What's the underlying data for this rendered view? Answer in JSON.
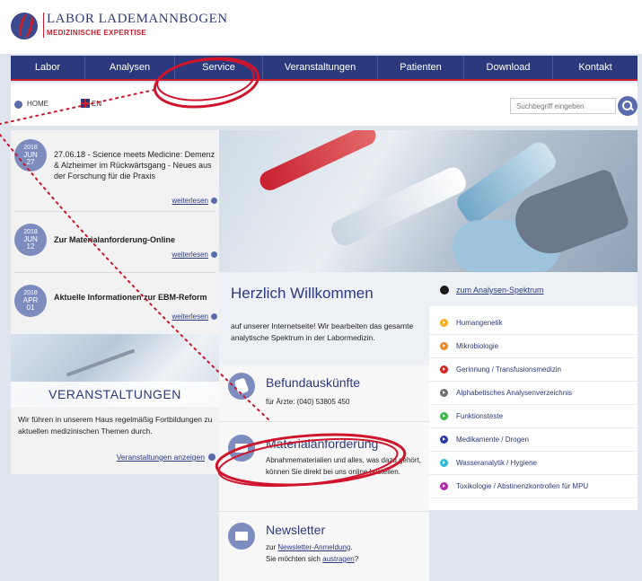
{
  "header": {
    "title": "LABOR LADEMANNBOGEN",
    "subtitle": "MEDIZINISCHE EXPERTISE"
  },
  "nav": {
    "items": [
      {
        "label": "Labor",
        "width": 83
      },
      {
        "label": "Analysen",
        "width": 100
      },
      {
        "label": "Service",
        "width": 98
      },
      {
        "label": "Veranstaltungen",
        "width": 128
      },
      {
        "label": "Patienten",
        "width": 96
      },
      {
        "label": "Download",
        "width": 99
      },
      {
        "label": "Kontakt",
        "width": 94
      }
    ]
  },
  "breadcrumb": {
    "home": "HOME",
    "lang": "EN"
  },
  "search": {
    "placeholder": "Suchbegriff eingeben"
  },
  "news": [
    {
      "year": "2018",
      "month": "JUN",
      "day": "27",
      "text": "27.06.18 - Science meets Medicine: Demenz & Alzheimer im Rückwärtsgang - Neues aus der Forschung für die Praxis",
      "more": "weiterlesen"
    },
    {
      "year": "2018",
      "month": "JUN",
      "day": "12",
      "text": "Zur Materialanforderung-Online",
      "more": "weiterlesen"
    },
    {
      "year": "2018",
      "month": "APR",
      "day": "01",
      "text": "Aktuelle Informationen zur EBM-Reform",
      "more": "weiterlesen"
    }
  ],
  "events": {
    "title": "VERANSTALTUNGEN",
    "text": "Wir führen in unserem Haus regelmäßig Fortbildungen zu aktuellen medizinischen Themen durch.",
    "link": "Veranstaltungen anzeigen"
  },
  "welcome": {
    "title": "Herzlich Willkommen",
    "text": "auf unserer Internetseite! Wir bearbeiten das gesamte analytische Spektrum in der Labormedizin."
  },
  "services": [
    {
      "title": "Befundauskünfte",
      "text": "für Ärzte: (040) 53805 450"
    },
    {
      "title": "Materialanforderung",
      "text": "Abnahmematerialien und alles, was dazu gehört, können Sie direkt bei uns online bestellen."
    },
    {
      "title": "Newsletter",
      "text_prefix": "zur ",
      "link1": "Newsletter-Anmeldung",
      "text_mid": ".",
      "text2": "Sie möchten sich ",
      "link2": "austragen",
      "text_end": "?"
    }
  ],
  "spectrum": {
    "head": "zum Analysen-Spektrum",
    "items": [
      {
        "label": "Humangenetik",
        "color": "#f2b01e"
      },
      {
        "label": "Mikrobiologie",
        "color": "#e8882a"
      },
      {
        "label": "Gerinnung / Transfusionsmedizin",
        "color": "#d42424"
      },
      {
        "label": "Alphabetisches Analysenverzeichnis",
        "color": "#6d6d6d"
      },
      {
        "label": "Funktionsteste",
        "color": "#3cb54a"
      },
      {
        "label": "Medikamente / Drogen",
        "color": "#2b3aa8"
      },
      {
        "label": "Wasseranalytik / Hygiene",
        "color": "#2cb8d8"
      },
      {
        "label": "Toxikologie / Abstinenzkontrollen für MPU",
        "color": "#b32aa8"
      }
    ]
  },
  "colors": {
    "nav_bg": "#2b3a7d",
    "accent_red": "#c8202f",
    "annotation": "#d0142c"
  }
}
